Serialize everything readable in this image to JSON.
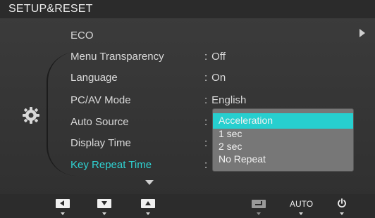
{
  "header": {
    "title": "SETUP&RESET"
  },
  "menu": {
    "items": [
      {
        "label": "ECO",
        "value": ""
      },
      {
        "label": "Menu Transparency",
        "value": "Off"
      },
      {
        "label": "Language",
        "value": "On"
      },
      {
        "label": "PC/AV Mode",
        "value": "English"
      },
      {
        "label": "Auto Source",
        "value": ""
      },
      {
        "label": "Display Time",
        "value": ""
      },
      {
        "label": "Key Repeat Time",
        "value": "",
        "active": true
      }
    ],
    "separator": ":"
  },
  "dropdown": {
    "options": [
      "Acceleration",
      "1 sec",
      "2 sec",
      "No Repeat"
    ],
    "selected_index": 0
  },
  "footer": {
    "auto_label": "AUTO"
  },
  "colors": {
    "accent": "#2fd2d2",
    "highlight": "#27cfcf",
    "panel": "#3a3a3a",
    "dropdown": "#777777"
  },
  "icons": {
    "category": "gear-icon",
    "submenu": "chevron-right-icon",
    "more": "chevron-down-icon",
    "footer": [
      "left-button-icon",
      "down-button-icon",
      "up-button-icon",
      "enter-button-icon",
      "power-icon"
    ]
  }
}
